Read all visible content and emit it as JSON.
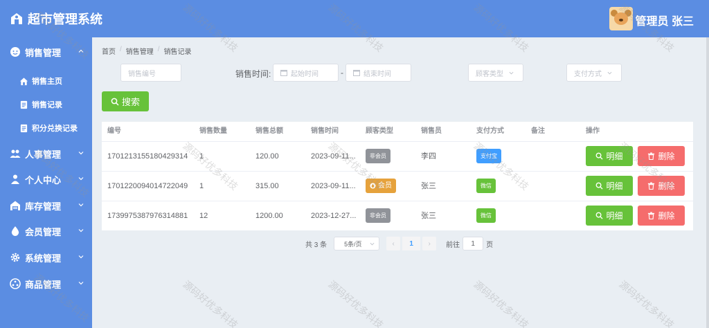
{
  "app": {
    "title": "超市管理系统",
    "user_label": "管理员 张三"
  },
  "sidebar": {
    "groups": [
      {
        "label": "销售管理",
        "icon": "smiley-icon"
      },
      {
        "label": "人事管理",
        "icon": "people-icon"
      },
      {
        "label": "个人中心",
        "icon": "person-icon"
      },
      {
        "label": "库存管理",
        "icon": "warehouse-icon"
      },
      {
        "label": "会员管理",
        "icon": "droplet-icon"
      },
      {
        "label": "系统管理",
        "icon": "gear-icon"
      },
      {
        "label": "商品管理",
        "icon": "settings-icon"
      }
    ],
    "sub_items": [
      {
        "label": "销售主页",
        "icon": "home-icon"
      },
      {
        "label": "销售记录",
        "icon": "document-icon"
      },
      {
        "label": "积分兑换记录",
        "icon": "document-icon"
      }
    ]
  },
  "breadcrumb": [
    "首页",
    "销售管理",
    "销售记录"
  ],
  "filters": {
    "sale_no_placeholder": "销售编号",
    "sale_time_label": "销售时间:",
    "start_placeholder": "起始时间",
    "dash": "-",
    "end_placeholder": "结束时间",
    "customer_type_placeholder": "顾客类型",
    "pay_method_placeholder": "支付方式",
    "search_label": "搜索"
  },
  "table": {
    "headers": [
      "编号",
      "销售数量",
      "销售总额",
      "销售时间",
      "顾客类型",
      "销售员",
      "支付方式",
      "备注",
      "操作"
    ],
    "rows": [
      {
        "id": "1701213155180429314",
        "qty": "1",
        "total": "120.00",
        "time": "2023-09-11...",
        "customer": "非会员",
        "seller": "李四",
        "pay": "支付宝",
        "remark": ""
      },
      {
        "id": "1701220094014722049",
        "qty": "1",
        "total": "315.00",
        "time": "2023-09-11...",
        "customer": "会员",
        "seller": "张三",
        "pay": "微信",
        "remark": ""
      },
      {
        "id": "1739975387976314881",
        "qty": "12",
        "total": "1200.00",
        "time": "2023-12-27...",
        "customer": "非会员",
        "seller": "张三",
        "pay": "微信",
        "remark": ""
      }
    ],
    "detail_label": "明细",
    "delete_label": "删除"
  },
  "pagination": {
    "total": "共 3 条",
    "page_size": "5条/页",
    "prev": "‹",
    "current": "1",
    "next": "›",
    "goto_prefix": "前往",
    "goto_value": "1",
    "goto_suffix": "页"
  },
  "watermark": "源码好优多科技",
  "colors": {
    "primary": "#5b8de2",
    "success": "#67c23a",
    "danger": "#f56c6c",
    "warning": "#e6a23c",
    "info": "#909399",
    "blue_tag": "#409eff"
  }
}
